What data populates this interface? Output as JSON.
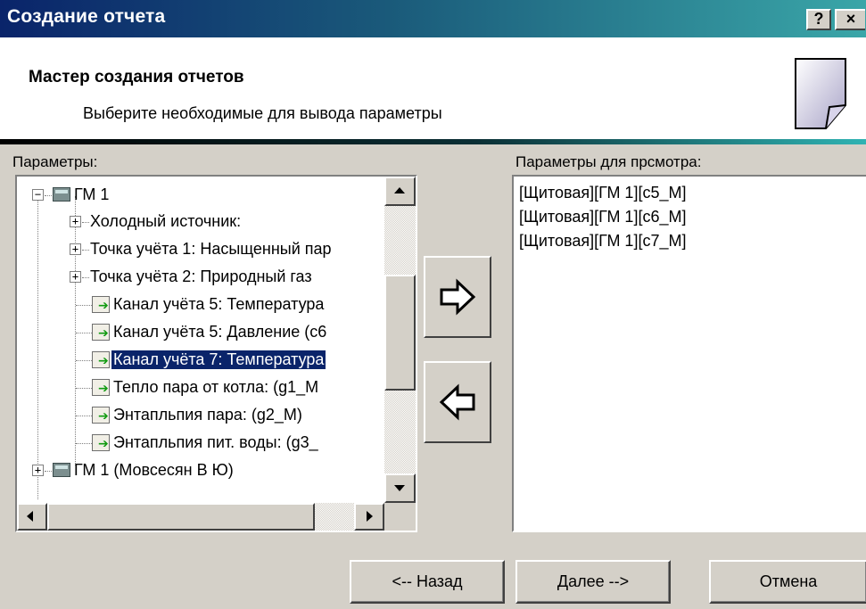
{
  "window": {
    "title": "Создание отчета",
    "help_label": "?",
    "close_label": "×"
  },
  "header": {
    "title": "Мастер создания отчетов",
    "subtitle": "Выберите необходимые для вывода параметры",
    "icon": "wizard-page-icon"
  },
  "left_panel": {
    "label": "Параметры:",
    "tree": [
      {
        "text": "ГМ 1",
        "icon": "device-icon",
        "expander": "−"
      },
      {
        "text": "Холодный источник:",
        "expander": "+"
      },
      {
        "text": "Точка учёта 1: Насыщенный пар",
        "expander": "+"
      },
      {
        "text": "Точка учёта 2: Природный газ",
        "expander": "+"
      },
      {
        "text": "Канал учёта 5: Температура",
        "icon": "channel-icon"
      },
      {
        "text": "Канал учёта 5: Давление  (c6",
        "icon": "channel-icon"
      },
      {
        "text": "Канал учёта 7: Температура",
        "icon": "channel-icon",
        "selected": true
      },
      {
        "text": "Тепло пара от котла:  (g1_M",
        "icon": "channel-icon"
      },
      {
        "text": "Энтапльпия пара:  (g2_M)",
        "icon": "channel-icon"
      },
      {
        "text": "Энтапльпия пит. воды:  (g3_",
        "icon": "channel-icon"
      },
      {
        "text": "ГМ 1 (Мовсесян В Ю)",
        "icon": "device-icon",
        "expander": "+"
      }
    ]
  },
  "transfer": {
    "add_icon": "arrow-right-icon",
    "remove_icon": "arrow-left-icon"
  },
  "right_panel": {
    "label": "Параметры для прсмотра:",
    "items": [
      "[Щитовая][ГМ 1][c5_M]",
      "[Щитовая][ГМ 1][c6_M]",
      "[Щитовая][ГМ 1][c7_M]"
    ]
  },
  "footer": {
    "back_label": "<-- Назад",
    "next_label": "Далее -->",
    "cancel_label": "Отмена"
  },
  "colors": {
    "titlebar_start": "#0a246a",
    "titlebar_end": "#3aa6a8",
    "selection": "#0a246a",
    "face": "#d4d0c8"
  }
}
